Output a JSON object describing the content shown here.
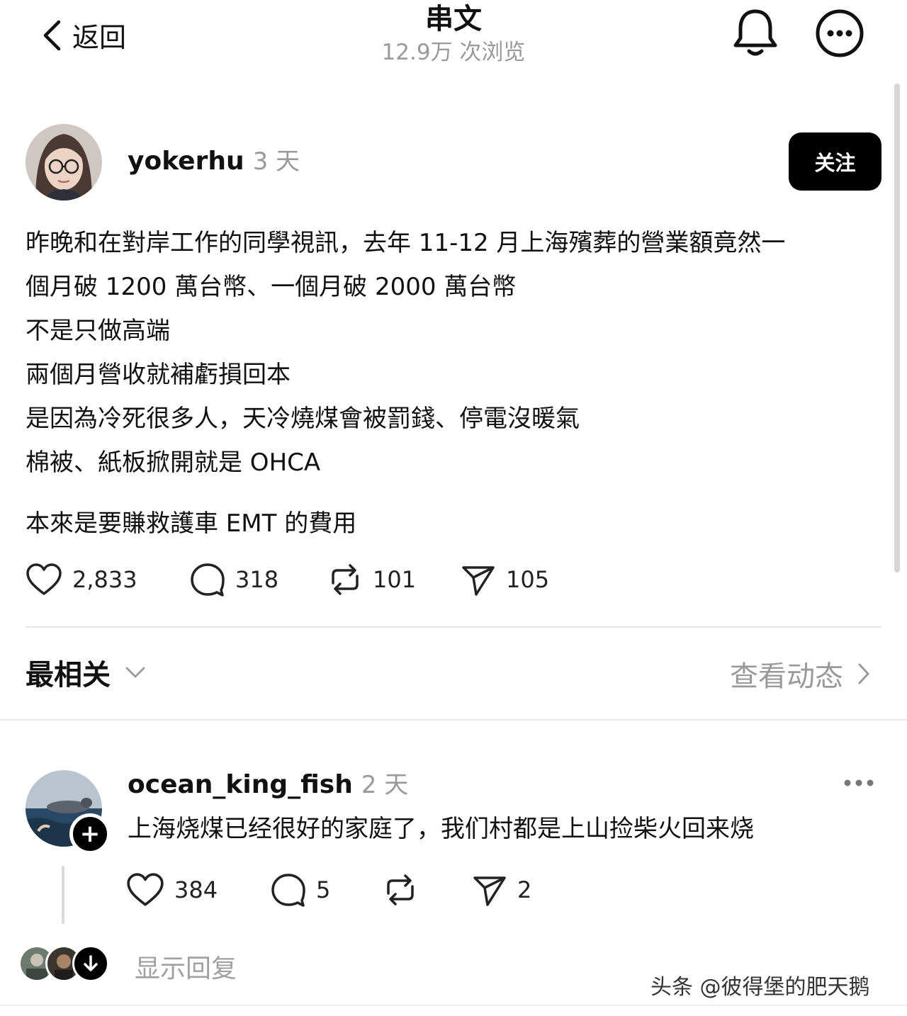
{
  "header": {
    "back_label": "返回",
    "title": "串文",
    "views": "12.9万 次浏览",
    "bell_icon": "bell-icon",
    "more_icon": "more-circle-icon"
  },
  "post": {
    "author": "yokerhu",
    "time": "3 天",
    "follow_label": "关注",
    "lines": [
      "昨晚和在對岸工作的同學視訊，去年 11-12 月上海殯葬的營業額竟然一",
      "個月破 1200 萬台幣、一個月破 2000 萬台幣",
      "不是只做高端",
      "兩個月營收就補虧損回本",
      "是因為冷死很多人，天冷燒煤會被罰錢、停電沒暖氣",
      "棉被、紙板掀開就是 OHCA",
      "本來是要賺救護車 EMT 的費用"
    ],
    "likes": "2,833",
    "comments": "318",
    "reposts": "101",
    "shares": "105"
  },
  "sort": {
    "label": "最相关",
    "activity_label": "查看动态"
  },
  "comment": {
    "author": "ocean_king_fish",
    "time": "2 天",
    "text": "上海烧煤已经很好的家庭了，我们村都是上山捡柴火回来烧",
    "likes": "384",
    "comments": "5",
    "shares": "2",
    "plus": "+",
    "show_replies": "显示回复"
  },
  "watermark": "头条 @彼得堡的肥天鹅",
  "colors": {
    "text": "#111111",
    "muted": "#9a9a9a",
    "button_bg": "#000000",
    "divider": "#e6e6e6"
  }
}
